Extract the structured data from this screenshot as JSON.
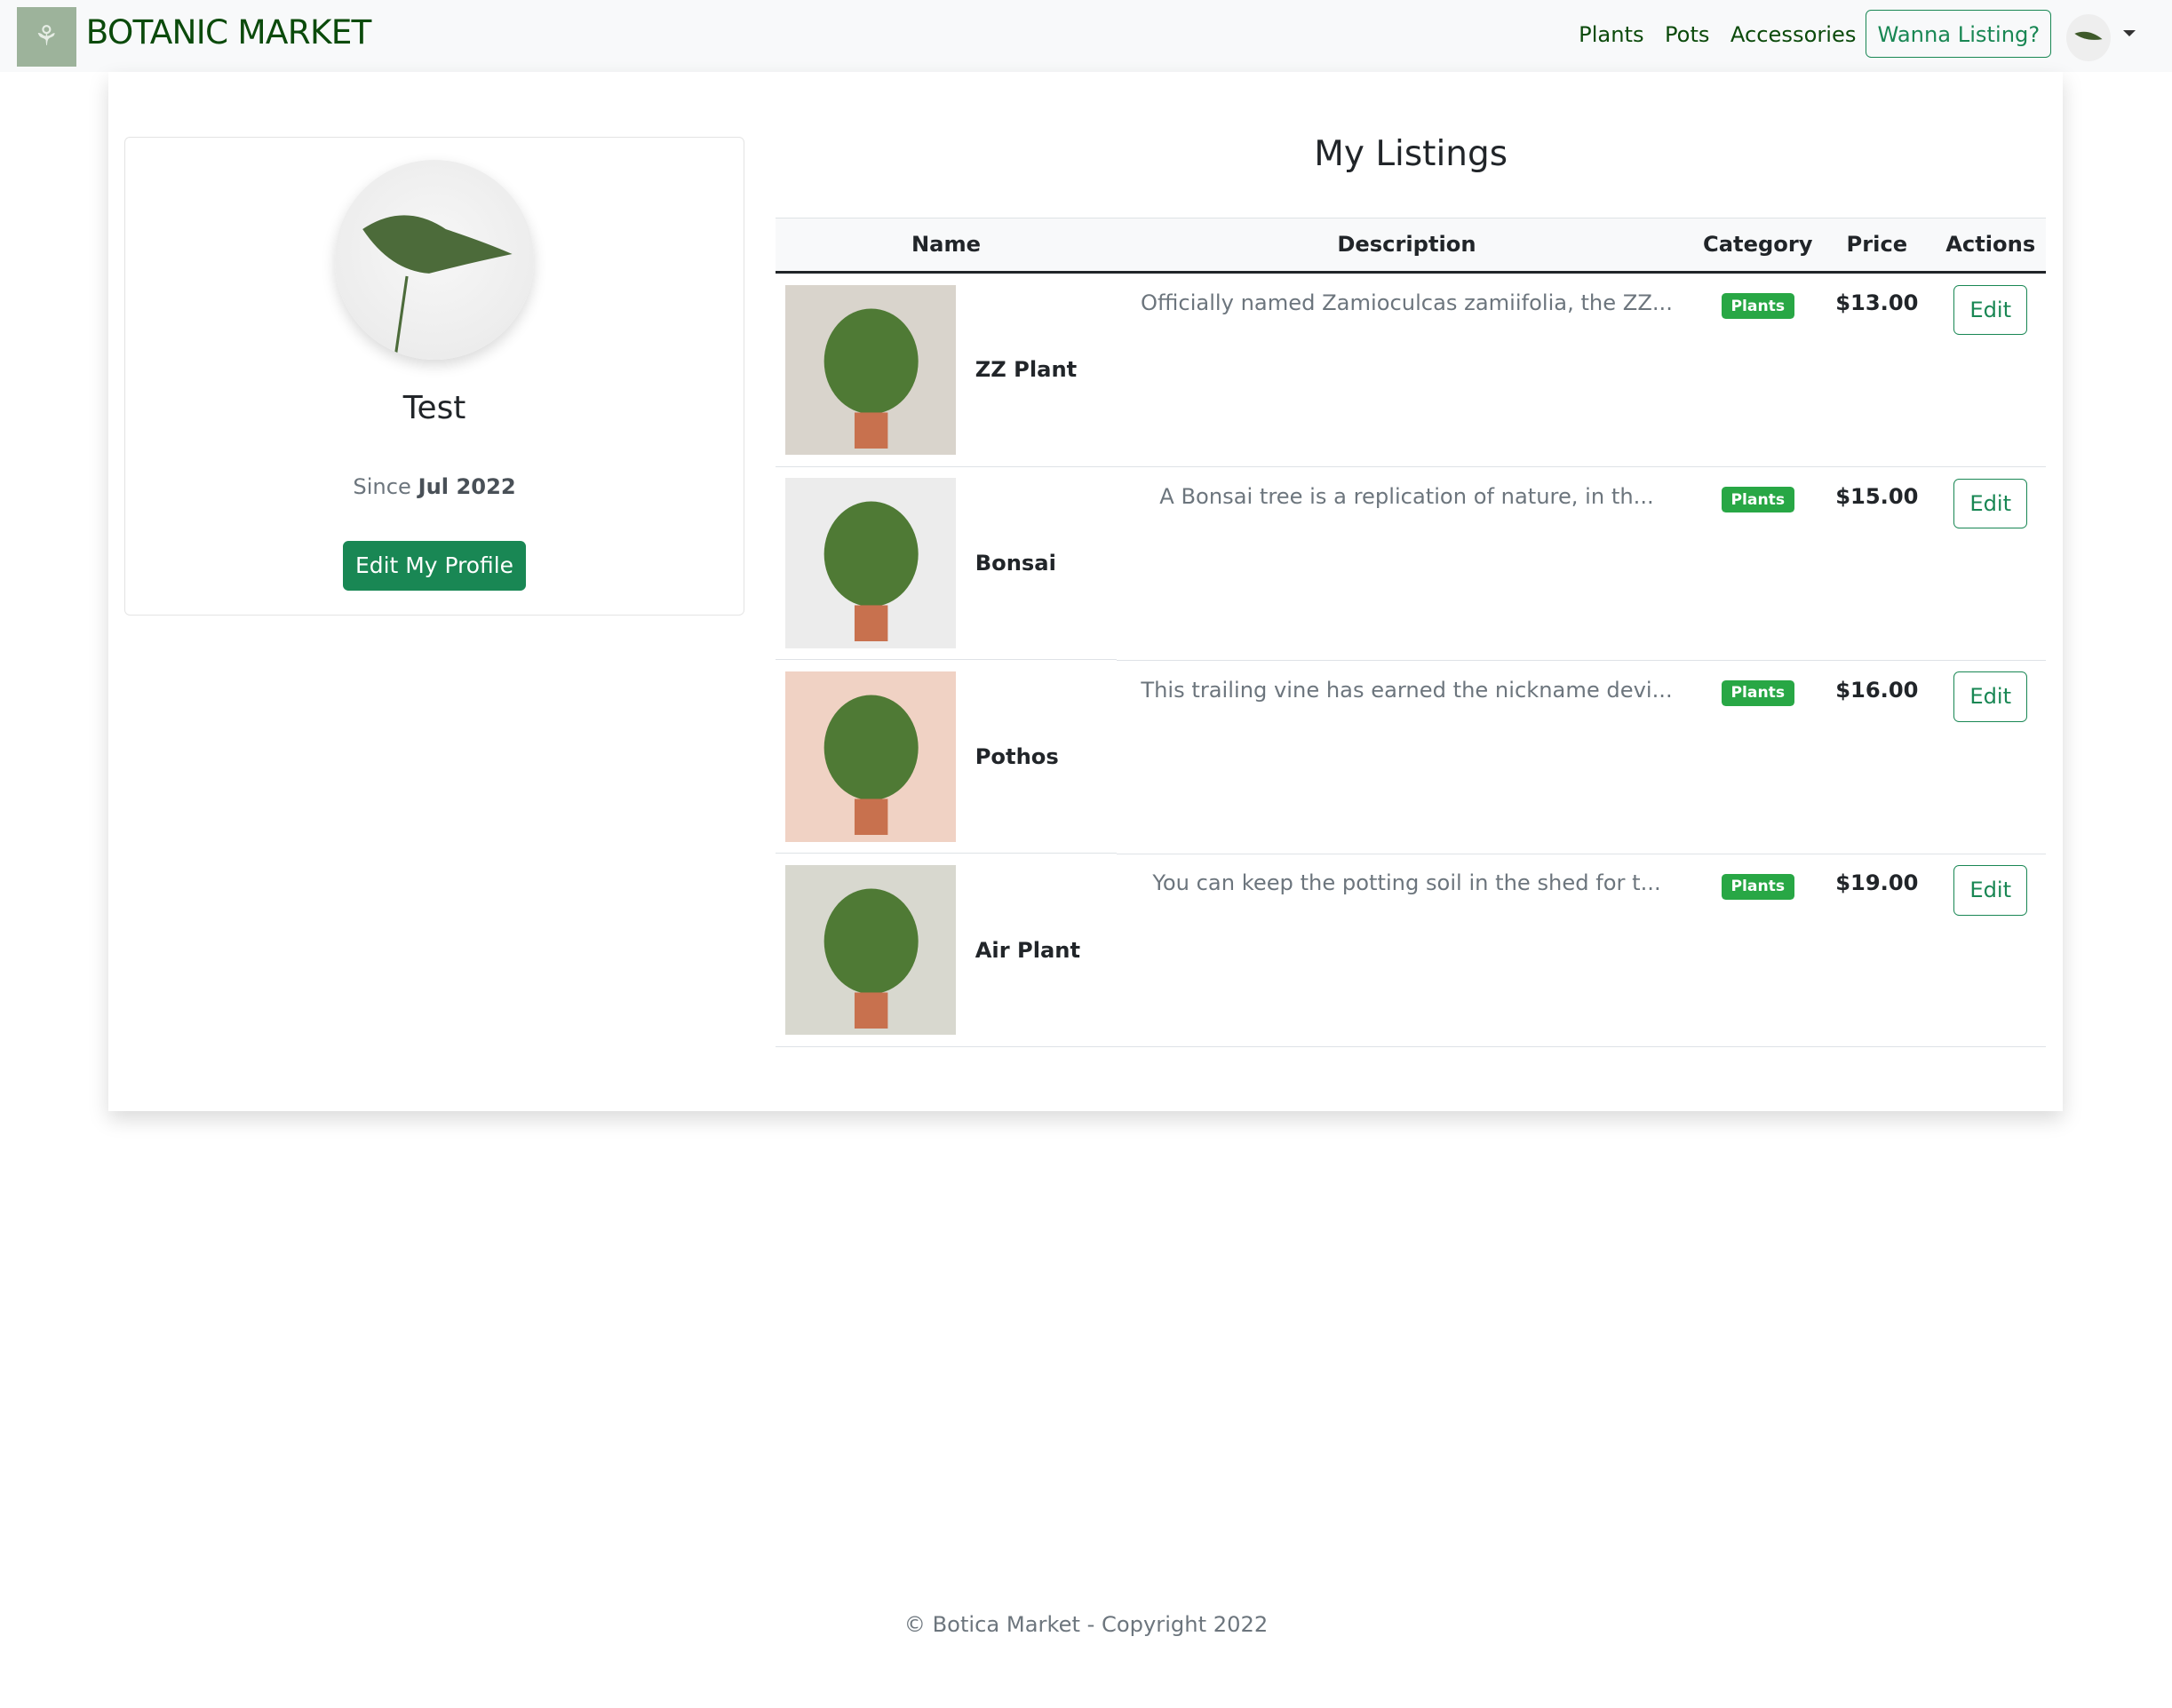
{
  "nav": {
    "brand": "BOTANIC MARKET",
    "links": [
      "Plants",
      "Pots",
      "Accessories"
    ],
    "cta": "Wanna Listing?",
    "logo_icon": "plant-sprig-icon",
    "avatar_icon": "leaf-avatar"
  },
  "profile": {
    "name": "Test",
    "since_label": "Since",
    "since_date": "Jul 2022",
    "edit_button": "Edit My Profile"
  },
  "listings": {
    "title": "My Listings",
    "columns": [
      "Name",
      "Description",
      "Category",
      "Price",
      "Actions"
    ],
    "rows": [
      {
        "name": "ZZ Plant",
        "description": "Officially named Zamioculcas zamiifolia, the ZZ...",
        "category": "Plants",
        "price": "$13.00",
        "action": "Edit",
        "img_bg": "#d9d4cc"
      },
      {
        "name": "Bonsai",
        "description": "A Bonsai tree is a replication of nature, in th...",
        "category": "Plants",
        "price": "$15.00",
        "action": "Edit",
        "img_bg": "#ececec"
      },
      {
        "name": "Pothos",
        "description": "This trailing vine has earned the nickname devi...",
        "category": "Plants",
        "price": "$16.00",
        "action": "Edit",
        "img_bg": "#f0d2c4"
      },
      {
        "name": "Air Plant",
        "description": "You can keep the potting soil in the shed for t...",
        "category": "Plants",
        "price": "$19.00",
        "action": "Edit",
        "img_bg": "#d8d8cf"
      }
    ]
  },
  "footer": "© Botica Market - Copyright 2022",
  "colors": {
    "accent": "#198754",
    "badge": "#28a745",
    "brand": "#0b4a0b"
  }
}
